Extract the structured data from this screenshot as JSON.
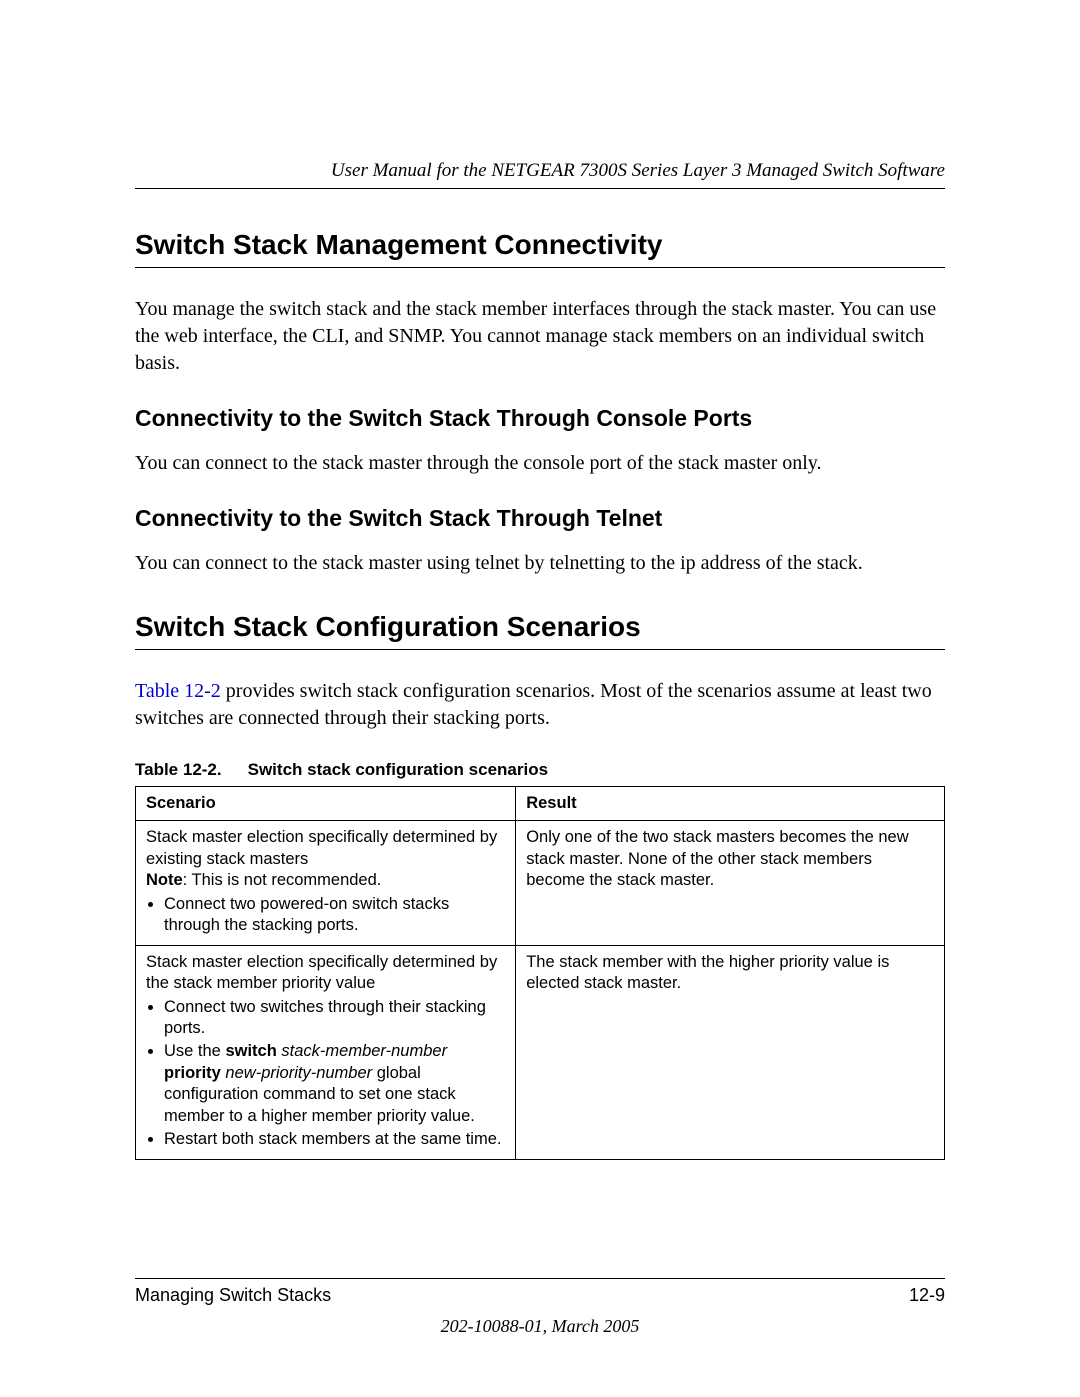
{
  "header": {
    "manual_title": "User Manual for the NETGEAR 7300S Series Layer 3 Managed Switch Software"
  },
  "section1": {
    "title": "Switch Stack Management Connectivity",
    "intro": "You manage the switch stack and the stack member interfaces through the stack master. You can use the web interface, the CLI, and SNMP. You cannot manage stack members on an individual switch basis.",
    "sub1_title": "Connectivity to the Switch Stack Through Console Ports",
    "sub1_body": "You can connect to the stack master through the console port of the stack master only.",
    "sub2_title": "Connectivity to the Switch Stack Through Telnet",
    "sub2_body": "You can connect to the stack master using telnet by telnetting to the ip address of the stack."
  },
  "section2": {
    "title": "Switch Stack Configuration Scenarios",
    "intro_prefix": "",
    "table_ref": "Table 12-2",
    "intro_suffix": " provides switch stack configuration scenarios. Most of the scenarios assume at least two switches are connected through their stacking ports."
  },
  "table": {
    "caption_label": "Table 12-2.",
    "caption_title": "Switch stack configuration scenarios",
    "headers": {
      "col1": "Scenario",
      "col2": "Result"
    },
    "rows": [
      {
        "scenario_lead": "Stack master election specifically determined by existing stack masters",
        "note_label": "Note",
        "note_text": ": This is not recommended.",
        "bullets": [
          "Connect two powered-on switch stacks through the stacking ports."
        ],
        "result": "Only one of the two stack masters becomes the new stack master. None of the other stack members become the stack master."
      },
      {
        "scenario_lead": "Stack master election specifically determined by the stack member priority value",
        "bullets_pre": [
          "Connect two switches through their stacking ports."
        ],
        "cmd_pre": "Use the ",
        "cmd_bold1": "switch",
        "cmd_italic1": " stack-member-number ",
        "cmd_bold2": "priority",
        "cmd_italic2": " new-priority-number",
        "cmd_post": " global configuration command to set one stack member to a higher member priority value.",
        "bullets_post": [
          "Restart both stack members at the same time."
        ],
        "result": "The stack member with the higher priority value is elected stack master."
      }
    ]
  },
  "footer": {
    "left": "Managing Switch Stacks",
    "right": "12-9",
    "docref": "202-10088-01, March 2005"
  }
}
